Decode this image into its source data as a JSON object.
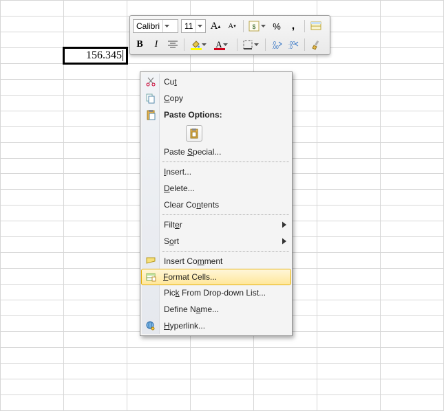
{
  "cell": {
    "value": "156.345"
  },
  "toolbar": {
    "font_name": "Calibri",
    "font_size": "11",
    "bold_glyph": "B",
    "italic_glyph": "I",
    "increase_font_glyph": "A",
    "decrease_font_glyph": "A",
    "accounting_glyph": "$",
    "percent_glyph": "%",
    "thousands_glyph": ",",
    "fontcolor_glyph": "A"
  },
  "menu": {
    "cut": "Cut",
    "copy_pre": "",
    "copy_m": "C",
    "copy_post": "opy",
    "paste_options": "Paste Options:",
    "paste_special_pre": "Paste ",
    "paste_special_m": "S",
    "paste_special_post": "pecial...",
    "insert_pre": "",
    "insert_m": "I",
    "insert_post": "nsert...",
    "delete_pre": "",
    "delete_m": "D",
    "delete_post": "elete...",
    "clear_pre": "Clear Co",
    "clear_m": "n",
    "clear_post": "tents",
    "filter_pre": "Filt",
    "filter_m": "e",
    "filter_post": "r",
    "sort_pre": "S",
    "sort_m": "o",
    "sort_post": "rt",
    "insert_comment_pre": "Insert Co",
    "insert_comment_m": "m",
    "insert_comment_post": "ment",
    "format_cells_pre": "",
    "format_cells_m": "F",
    "format_cells_post": "ormat Cells...",
    "pick_pre": "Pic",
    "pick_m": "k",
    "pick_post": " From Drop-down List...",
    "define_pre": "Define N",
    "define_m": "a",
    "define_post": "me...",
    "hyperlink_pre": "",
    "hyperlink_m": "H",
    "hyperlink_post": "yperlink..."
  }
}
